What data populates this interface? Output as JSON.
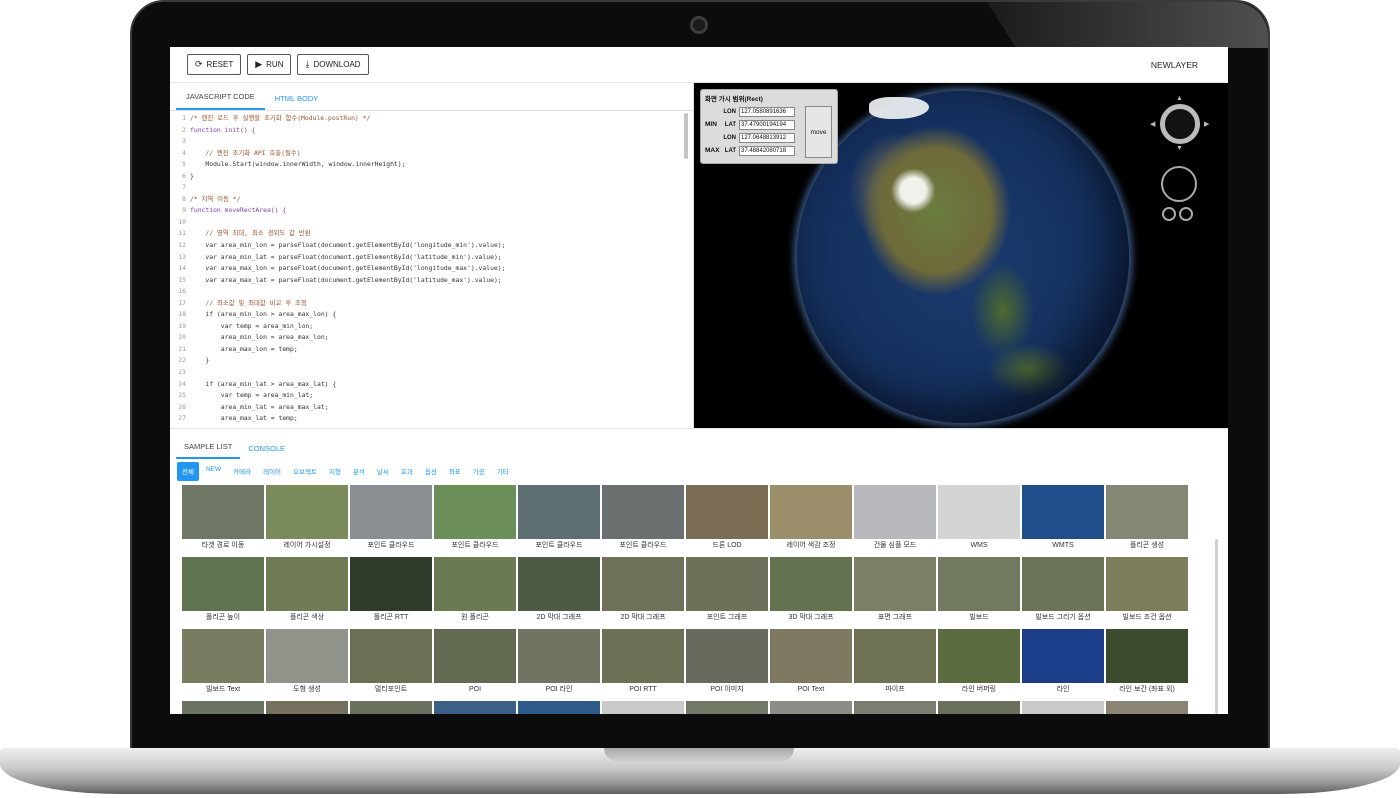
{
  "toolbar": {
    "reset_label": "RESET",
    "run_label": "RUN",
    "download_label": "DOWNLOAD",
    "newlayer_label": "NEWLAYER"
  },
  "editor": {
    "tabs": [
      "JAVASCRIPT CODE",
      "HTML BODY"
    ],
    "lines": [
      {
        "n": "1",
        "t": "/* 렌진 로드 후 실행할 초기화 함수(Module.postRun) */",
        "c": "cm"
      },
      {
        "n": "2",
        "t": "function init() {",
        "c": "kw"
      },
      {
        "n": "3",
        "t": "",
        "c": ""
      },
      {
        "n": "4",
        "t": "    // 엔진 초기화 API 호출(필수)",
        "c": "cm"
      },
      {
        "n": "5",
        "t": "    Module.Start(window.innerWidth, window.innerHeight);",
        "c": ""
      },
      {
        "n": "6",
        "t": "}",
        "c": ""
      },
      {
        "n": "7",
        "t": "",
        "c": ""
      },
      {
        "n": "8",
        "t": "/* 지역 이동 */",
        "c": "cm"
      },
      {
        "n": "9",
        "t": "function moveRectArea() {",
        "c": "kw"
      },
      {
        "n": "10",
        "t": "",
        "c": ""
      },
      {
        "n": "11",
        "t": "    // 영역 최대, 최소 경위도 값 반환",
        "c": "cm"
      },
      {
        "n": "12",
        "t": "    var area_min_lon = parseFloat(document.getElementById('longitude_min').value);",
        "c": ""
      },
      {
        "n": "13",
        "t": "    var area_min_lat = parseFloat(document.getElementById('latitude_min').value);",
        "c": ""
      },
      {
        "n": "14",
        "t": "    var area_max_lon = parseFloat(document.getElementById('longitude_max').value);",
        "c": ""
      },
      {
        "n": "15",
        "t": "    var area_max_lat = parseFloat(document.getElementById('latitude_max').value);",
        "c": ""
      },
      {
        "n": "16",
        "t": "",
        "c": ""
      },
      {
        "n": "17",
        "t": "    // 최소값 및 최대값 비교 후 조정",
        "c": "cm"
      },
      {
        "n": "18",
        "t": "    if (area_min_lon > area_max_lon) {",
        "c": ""
      },
      {
        "n": "19",
        "t": "        var temp = area_min_lon;",
        "c": ""
      },
      {
        "n": "20",
        "t": "        area_min_lon = area_max_lon;",
        "c": ""
      },
      {
        "n": "21",
        "t": "        area_max_lon = temp;",
        "c": ""
      },
      {
        "n": "22",
        "t": "    }",
        "c": ""
      },
      {
        "n": "23",
        "t": "",
        "c": ""
      },
      {
        "n": "24",
        "t": "    if (area_min_lat > area_max_lat) {",
        "c": ""
      },
      {
        "n": "25",
        "t": "        var temp = area_min_lat;",
        "c": ""
      },
      {
        "n": "26",
        "t": "        area_min_lat = area_max_lat;",
        "c": ""
      },
      {
        "n": "27",
        "t": "        area_max_lat = temp;",
        "c": ""
      }
    ]
  },
  "map": {
    "panel_title": "화면 가시 범위(Rect)",
    "min_label": "MIN",
    "max_label": "MAX",
    "lon_label": "LON",
    "lat_label": "LAT",
    "min_lon": "127.0580891636",
    "min_lat": "37.47900194194",
    "max_lon": "127.0648813912",
    "max_lat": "37.48842080718",
    "move_label": "move"
  },
  "lower": {
    "tabs": [
      "SAMPLE LIST",
      "CONSOLE"
    ],
    "categories": [
      "전체",
      "NEW",
      "카메라",
      "레이어",
      "오브젝트",
      "지형",
      "분석",
      "날씨",
      "효과",
      "옵션",
      "좌표",
      "가공",
      "기타"
    ],
    "samples": [
      {
        "label": "타겟 경로 이동",
        "color": "#6e7763"
      },
      {
        "label": "레이어 가시설정",
        "color": "#7b8a5b"
      },
      {
        "label": "포인트 클라우드",
        "color": "#8a8f93"
      },
      {
        "label": "포인트 클라우드",
        "color": "#6c8f5a"
      },
      {
        "label": "포인트 클라우드",
        "color": "#5d6e72"
      },
      {
        "label": "포인트 클라우드",
        "color": "#6a6f70"
      },
      {
        "label": "드론 LOD",
        "color": "#7b6d54"
      },
      {
        "label": "레이어 색감 조정",
        "color": "#9a8f6a"
      },
      {
        "label": "건물 심플 모드",
        "color": "#b7b8bc"
      },
      {
        "label": "WMS",
        "color": "#d4d4d4"
      },
      {
        "label": "WMTS",
        "color": "#1f4f8a"
      },
      {
        "label": "폴리곤 생성",
        "color": "#838774"
      },
      {
        "label": "폴리곤 높이",
        "color": "#5f7350"
      },
      {
        "label": "폴리곤 색상",
        "color": "#6e7b54"
      },
      {
        "label": "폴리곤 RTT",
        "color": "#2f3a2a"
      },
      {
        "label": "원 폴리곤",
        "color": "#6b7a52"
      },
      {
        "label": "2D 막대 그래프",
        "color": "#4d5a44"
      },
      {
        "label": "2D 막대 그래프",
        "color": "#6f705a"
      },
      {
        "label": "포인트 그래프",
        "color": "#6d6f58"
      },
      {
        "label": "3D 막대 그래프",
        "color": "#64724f"
      },
      {
        "label": "표면 그래프",
        "color": "#7b7f65"
      },
      {
        "label": "빌보드",
        "color": "#717a60"
      },
      {
        "label": "빌보드 그리기 옵션",
        "color": "#6c7458"
      },
      {
        "label": "빌보드 조건 옵션",
        "color": "#7d7d5e"
      },
      {
        "label": "빌보드 Text",
        "color": "#7a7c62"
      },
      {
        "label": "도형 생성",
        "color": "#8f938a"
      },
      {
        "label": "멀티포인트",
        "color": "#6b7054"
      },
      {
        "label": "POI",
        "color": "#636a52"
      },
      {
        "label": "POI 라인",
        "color": "#6f7560"
      },
      {
        "label": "POI RTT",
        "color": "#6a7154"
      },
      {
        "label": "POI 이미지",
        "color": "#666b5e"
      },
      {
        "label": "POI Text",
        "color": "#7e7a62"
      },
      {
        "label": "파이프",
        "color": "#6f7153"
      },
      {
        "label": "라인 버퍼링",
        "color": "#5a6b3f"
      },
      {
        "label": "라인",
        "color": "#1c3d8a"
      },
      {
        "label": "라인 보간 (좌표 외)",
        "color": "#3c4a2e"
      },
      {
        "label": "",
        "color": "#6b7462"
      },
      {
        "label": "",
        "color": "#75715d"
      },
      {
        "label": "",
        "color": "#69705d"
      },
      {
        "label": "",
        "color": "#3b5f85"
      },
      {
        "label": "",
        "color": "#2f5b8a"
      },
      {
        "label": "",
        "color": "#c9c9c9"
      },
      {
        "label": "",
        "color": "#727866"
      },
      {
        "label": "",
        "color": "#8d8d88"
      },
      {
        "label": "",
        "color": "#7b7d70"
      },
      {
        "label": "",
        "color": "#6a6f5c"
      },
      {
        "label": "",
        "color": "#c9c9c9"
      },
      {
        "label": "",
        "color": "#8b8373"
      }
    ]
  }
}
